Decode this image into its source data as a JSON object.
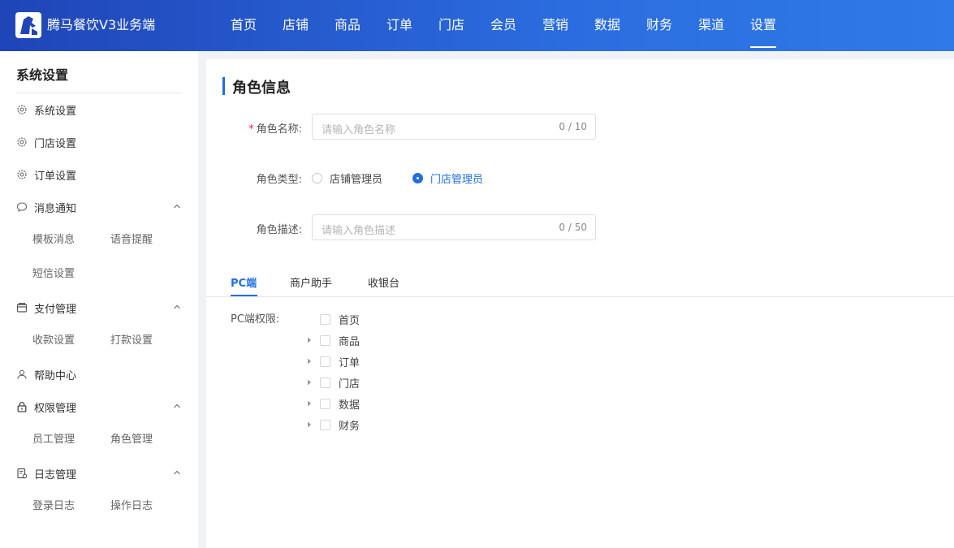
{
  "header": {
    "brand": "腾马餐饮V3业务端",
    "nav": [
      "首页",
      "店铺",
      "商品",
      "订单",
      "门店",
      "会员",
      "营销",
      "数据",
      "财务",
      "渠道",
      "设置"
    ],
    "active_nav": "设置"
  },
  "sidebar": {
    "title": "系统设置",
    "items": [
      {
        "label": "系统设置",
        "icon": "gear-icon"
      },
      {
        "label": "门店设置",
        "icon": "gear-icon"
      },
      {
        "label": "订单设置",
        "icon": "gear-icon"
      },
      {
        "label": "消息通知",
        "icon": "chat-icon",
        "expanded": true,
        "children": [
          "模板消息",
          "语音提醒",
          "短信设置"
        ]
      },
      {
        "label": "支付管理",
        "icon": "wallet-icon",
        "expanded": true,
        "children": [
          "收款设置",
          "打款设置"
        ]
      },
      {
        "label": "帮助中心",
        "icon": "user-icon"
      },
      {
        "label": "权限管理",
        "icon": "lock-icon",
        "expanded": true,
        "children": [
          "员工管理",
          "角色管理"
        ]
      },
      {
        "label": "日志管理",
        "icon": "log-icon",
        "expanded": true,
        "children": [
          "登录日志",
          "操作日志"
        ]
      }
    ]
  },
  "main": {
    "section_title": "角色信息",
    "form": {
      "name_label": "角色名称:",
      "name_required": "*",
      "name_placeholder": "请输入角色名称",
      "name_count": "0 / 10",
      "type_label": "角色类型:",
      "type_options": [
        "店铺管理员",
        "门店管理员"
      ],
      "type_selected": "门店管理员",
      "desc_label": "角色描述:",
      "desc_placeholder": "请输入角色描述",
      "desc_count": "0 / 50"
    },
    "tabs": [
      "PC端",
      "商户助手",
      "收银台"
    ],
    "active_tab": "PC端",
    "perm_label": "PC端权限:",
    "perm_tree": [
      {
        "label": "首页",
        "expandable": false
      },
      {
        "label": "商品",
        "expandable": true
      },
      {
        "label": "订单",
        "expandable": true
      },
      {
        "label": "门店",
        "expandable": true
      },
      {
        "label": "数据",
        "expandable": true
      },
      {
        "label": "财务",
        "expandable": true
      }
    ]
  },
  "colors": {
    "accent": "#1f6fe5",
    "header_start": "#1f45b8",
    "header_end": "#2f7ae6"
  }
}
